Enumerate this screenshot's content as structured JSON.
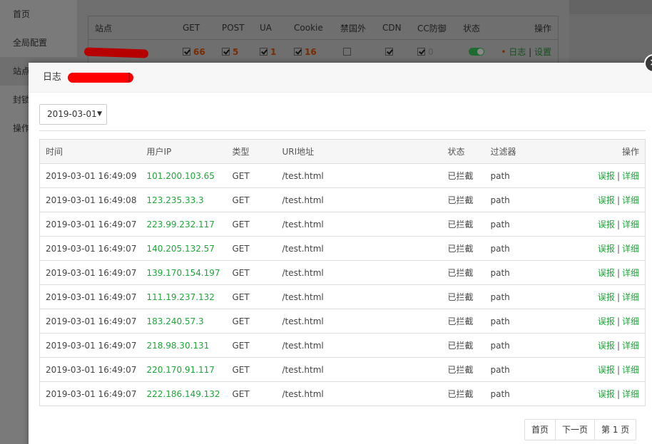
{
  "sidebar": {
    "items": [
      "首页",
      "全局配置",
      "站点",
      "封锁",
      "操作"
    ]
  },
  "bg_table": {
    "headers": [
      "站点",
      "GET",
      "POST",
      "UA",
      "Cookie",
      "禁国外",
      "CDN",
      "CC防御",
      "状态",
      "操作"
    ],
    "row": {
      "get": "66",
      "post": "5",
      "ua": "1",
      "cookie": "16",
      "cc": "0",
      "bullet": "•",
      "link_log": "日志",
      "link_sep": "|",
      "link_settings": "设置"
    }
  },
  "modal": {
    "title_prefix": "日志",
    "title_suffix": "]",
    "close_glyph": "×",
    "date_value": "2019-03-01",
    "date_arrow": "▼",
    "columns": [
      "时间",
      "用户IP",
      "类型",
      "URI地址",
      "状态",
      "过滤器",
      "操作"
    ],
    "op_false": "误报",
    "op_sep": "|",
    "op_detail": "详细",
    "rows": [
      {
        "time": "2019-03-01 16:49:09",
        "ip": "101.200.103.65",
        "type": "GET",
        "uri": "/test.html",
        "status": "已拦截",
        "filter": "path"
      },
      {
        "time": "2019-03-01 16:49:08",
        "ip": "123.235.33.3",
        "type": "GET",
        "uri": "/test.html",
        "status": "已拦截",
        "filter": "path"
      },
      {
        "time": "2019-03-01 16:49:07",
        "ip": "223.99.232.117",
        "type": "GET",
        "uri": "/test.html",
        "status": "已拦截",
        "filter": "path"
      },
      {
        "time": "2019-03-01 16:49:07",
        "ip": "140.205.132.57",
        "type": "GET",
        "uri": "/test.html",
        "status": "已拦截",
        "filter": "path"
      },
      {
        "time": "2019-03-01 16:49:07",
        "ip": "139.170.154.197",
        "type": "GET",
        "uri": "/test.html",
        "status": "已拦截",
        "filter": "path"
      },
      {
        "time": "2019-03-01 16:49:07",
        "ip": "111.19.237.132",
        "type": "GET",
        "uri": "/test.html",
        "status": "已拦截",
        "filter": "path"
      },
      {
        "time": "2019-03-01 16:49:07",
        "ip": "183.240.57.3",
        "type": "GET",
        "uri": "/test.html",
        "status": "已拦截",
        "filter": "path"
      },
      {
        "time": "2019-03-01 16:49:07",
        "ip": "218.98.30.131",
        "type": "GET",
        "uri": "/test.html",
        "status": "已拦截",
        "filter": "path"
      },
      {
        "time": "2019-03-01 16:49:07",
        "ip": "220.170.91.117",
        "type": "GET",
        "uri": "/test.html",
        "status": "已拦截",
        "filter": "path"
      },
      {
        "time": "2019-03-01 16:49:07",
        "ip": "222.186.149.132",
        "type": "GET",
        "uri": "/test.html",
        "status": "已拦截",
        "filter": "path"
      }
    ],
    "pager": {
      "first": "首页",
      "next": "下一页",
      "current": "第 1 页"
    }
  },
  "colors": {
    "accent_green": "#20a53a",
    "redaction": "#ff0000"
  }
}
